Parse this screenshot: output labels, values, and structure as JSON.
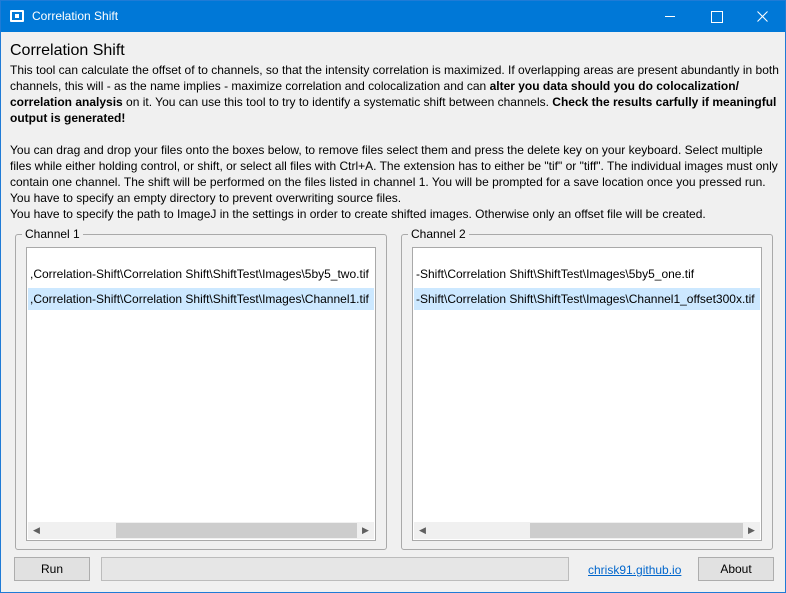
{
  "window": {
    "title": "Correlation Shift",
    "app_icon": "window-icon",
    "controls": [
      "minimize",
      "maximize",
      "close"
    ]
  },
  "heading": "Correlation Shift",
  "description": {
    "p1_a": "This tool can calculate the offset of to channels, so that the intensity correlation is maximized. If overlapping areas are present abundantly in both channels, this will - as the name implies - maximize correlation and colocalization and can ",
    "p1_bold_1": "alter you data should you do colocalization/ correlation analysis",
    "p1_b": " on it. You can use this tool to try to identify a systematic shift between channels. ",
    "p1_bold_2": "Check the results carfully if meaningful output is generated!",
    "p2": "You can drag and drop your files onto the boxes below, to remove files select them and press the delete key on your keyboard. Select multiple files while either holding control, or shift, or select all files with Ctrl+A. The extension has to either be \"tif\" or \"tiff\". The individual images must only contain one channel. The shift will be performed on the files listed in channel 1. You will be prompted for a save location once you pressed run. You have to specify an empty directory to prevent overwriting source files.",
    "p3": "You have to specify the path to ImageJ in the settings in order to create shifted images. Otherwise only an offset file will be created."
  },
  "channel1": {
    "label": "Channel 1",
    "items": [
      ",Correlation-Shift\\Correlation Shift\\ShiftTest\\Images\\5by5_two.tif",
      ",Correlation-Shift\\Correlation Shift\\ShiftTest\\Images\\Channel1.tif"
    ],
    "selected_index": 1
  },
  "channel2": {
    "label": "Channel 2",
    "items": [
      "-Shift\\Correlation Shift\\ShiftTest\\Images\\5by5_one.tif",
      "-Shift\\Correlation Shift\\ShiftTest\\Images\\Channel1_offset300x.tif"
    ],
    "selected_index": 1
  },
  "footer": {
    "run_label": "Run",
    "progress": 0,
    "link_text": "chrisk91.github.io",
    "about_label": "About"
  },
  "colors": {
    "titlebar": "#0078d7",
    "selection": "#cce8ff",
    "link": "#0066cc",
    "progress_fill": "#06b025"
  }
}
